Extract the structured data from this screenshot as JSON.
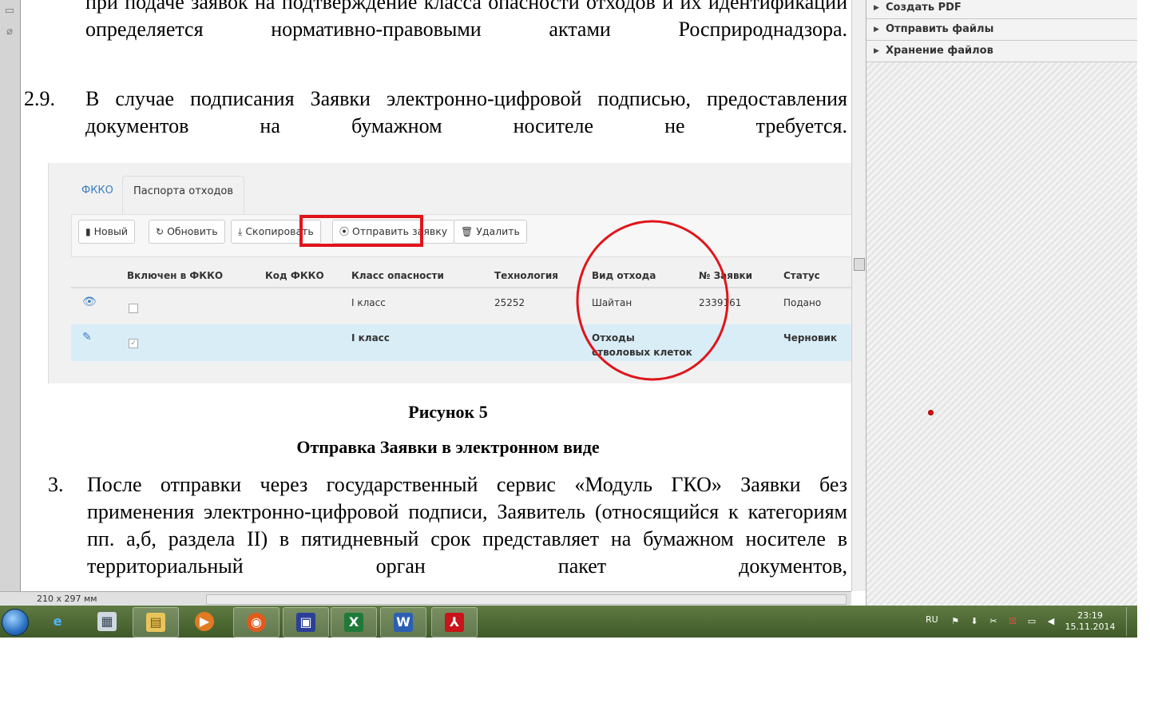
{
  "document": {
    "para_top": "при подаче заявок на подтверждение класса опасности отходов и их идентификации определяется нормативно-правовыми актами Росприроднадзора.",
    "item_2_9_number": "2.9.",
    "item_2_9_text": "В случае подписания Заявки электронно-цифровой подписью, предоставления документов на бумажном носителе не требуется.",
    "figure_caption_1": "Рисунок 5",
    "figure_caption_2": "Отправка Заявки в электронном виде",
    "item_3_number": "3.",
    "item_3_text": "После отправки через государственный сервис «Модуль ГКО» Заявки без применения электронно-цифровой подписи, Заявитель (относящийся к категориям пп. а,б, раздела II) в пятидневный срок представляет на бумажном носителе в территориальный орган пакет документов,"
  },
  "figure": {
    "tabs": [
      {
        "label": "ФККО"
      },
      {
        "label": "Паспорта отходов"
      }
    ],
    "toolbar": {
      "new": "Новый",
      "refresh": "Обновить",
      "copy": "Скопировать",
      "send": "Отправить заявку",
      "delete": "Удалить"
    },
    "columns": {
      "included": "Включен в ФККО",
      "code": "Код ФККО",
      "hazard": "Класс опасности",
      "technology": "Технология",
      "waste_type": "Вид отхода",
      "request_no": "№ Заявки",
      "status": "Статус"
    },
    "rows": [
      {
        "hazard": "I класс",
        "technology": "25252",
        "waste_type": "Шайтан",
        "request_no": "2339161",
        "status": "Подано",
        "checked": false
      },
      {
        "hazard": "I класс",
        "technology": "",
        "waste_type": "Отходы стволовых клеток",
        "request_no": "",
        "status": "Черновик",
        "checked": true
      }
    ]
  },
  "status_bar": {
    "page_size": "210 x 297 мм"
  },
  "right_panel": {
    "items": [
      {
        "label": "Создать PDF"
      },
      {
        "label": "Отправить файлы"
      },
      {
        "label": "Хранение файлов"
      }
    ]
  },
  "taskbar": {
    "apps": [
      {
        "icon": "ie-icon"
      },
      {
        "icon": "calculator-icon"
      },
      {
        "icon": "explorer-icon"
      },
      {
        "icon": "media-player-icon"
      },
      {
        "icon": "firefox-icon"
      },
      {
        "icon": "save-floppy-icon"
      },
      {
        "icon": "excel-icon"
      },
      {
        "icon": "word-icon"
      },
      {
        "icon": "acrobat-icon"
      }
    ],
    "language": "RU",
    "time": "23:19",
    "date": "15.11.2014"
  },
  "colors": {
    "highlight_red": "#e0151a",
    "link_blue": "#3a7fc1",
    "selected_row": "#d9edf7"
  }
}
